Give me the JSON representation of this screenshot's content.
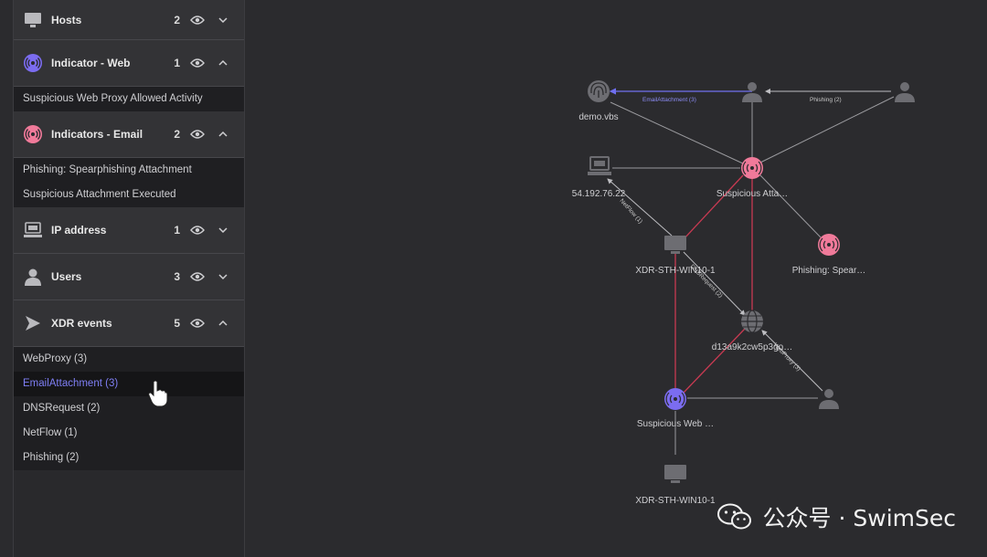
{
  "sidebar": {
    "groups": [
      {
        "label": "Hosts",
        "count": "2",
        "expanded": false,
        "icon": "monitor-icon"
      },
      {
        "label": "Indicator - Web",
        "count": "1",
        "expanded": true,
        "icon": "web-indicator-icon",
        "items": [
          "Suspicious Web Proxy Allowed Activity"
        ]
      },
      {
        "label": "Indicators - Email",
        "count": "2",
        "expanded": true,
        "icon": "email-indicator-icon",
        "items": [
          "Phishing: Spearphishing Attachment",
          "Suspicious Attachment Executed"
        ]
      },
      {
        "label": "IP address",
        "count": "1",
        "expanded": false,
        "icon": "ip-address-icon"
      },
      {
        "label": "Users",
        "count": "3",
        "expanded": false,
        "icon": "user-icon"
      },
      {
        "label": "XDR events",
        "count": "5",
        "expanded": true,
        "icon": "xdr-events-icon",
        "items": [
          "WebProxy (3)",
          "EmailAttachment (3)",
          "DNSRequest (2)",
          "NetFlow (1)",
          "Phishing (2)"
        ],
        "active_item": "EmailAttachment (3)"
      }
    ]
  },
  "graph": {
    "nodes": {
      "file": {
        "label": "demo.vbs",
        "icon": "fingerprint-icon"
      },
      "user_top_mid": {
        "label": "",
        "icon": "user-icon"
      },
      "user_top_right": {
        "label": "",
        "icon": "user-icon"
      },
      "ip": {
        "label": "54.192.76.22",
        "icon": "monitor-icon"
      },
      "susp_attach": {
        "label": "Suspicious Atta…",
        "icon": "email-indicator-icon"
      },
      "host_main": {
        "label": "XDR-STH-WIN10-1",
        "icon": "monitor-icon"
      },
      "phishing_spear": {
        "label": "Phishing: Spear…",
        "icon": "email-indicator-icon"
      },
      "domain": {
        "label": "d13a9k2cw5p3go…",
        "icon": "globe-icon"
      },
      "susp_web": {
        "label": "Suspicious Web …",
        "icon": "web-indicator-icon"
      },
      "user_bottom": {
        "label": "",
        "icon": "user-icon"
      },
      "host_bottom": {
        "label": "XDR-STH-WIN10-1",
        "icon": "monitor-icon"
      }
    },
    "edge_labels": {
      "email_attachment": "EmailAttachment (3)",
      "phishing": "Phishing (2)",
      "netflow": "NetFlow (1)",
      "dns_request": "DNSRequest (2)",
      "web_proxy": "WebProxy (3)"
    },
    "colors": {
      "edge": "#9a9a9e",
      "highlight_edge": "#c83a52",
      "selected_edge": "#6f6ff0",
      "email_indicator": "#f07a9a",
      "web_indicator": "#7b6cf0",
      "neutral_icon": "#6d6d72"
    }
  },
  "watermark": {
    "text": "公众号 · SwimSec",
    "icon": "wechat-icon"
  }
}
